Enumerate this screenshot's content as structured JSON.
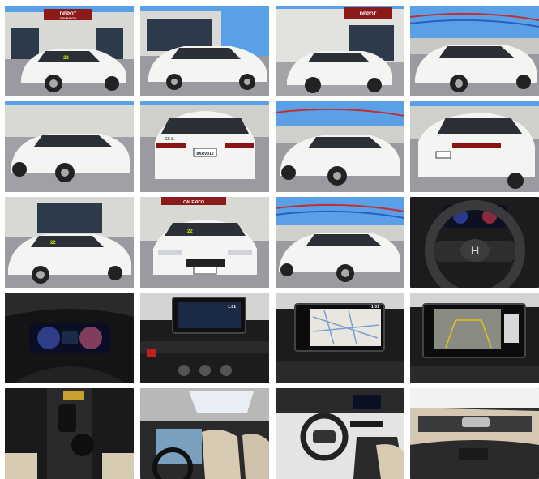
{
  "gallery": {
    "dealer_sign_line1": "DEPOT",
    "dealer_sign_line2": "CALEXICO",
    "dealer_sign_short": "CALEXICO",
    "windshield_tag": "22",
    "plate_text": "8XRV312",
    "trim_badge": "EX-L",
    "screen_time": "1:01"
  },
  "colors": {
    "car_body": "#f4f4f2",
    "sky": "#5aa0e6",
    "asphalt": "#9a9aa0",
    "building": "#d8d8d4",
    "glass": "#2d3a4a",
    "interior_dark": "#1c1c1e",
    "leather": "#d8cbb4"
  },
  "photos": [
    {
      "icon": "car-front-dealer-photo"
    },
    {
      "icon": "car-side-front-photo"
    },
    {
      "icon": "car-front-building-photo"
    },
    {
      "icon": "car-front-flags-photo"
    },
    {
      "icon": "car-side-profile-photo"
    },
    {
      "icon": "car-rear-photo"
    },
    {
      "icon": "car-side-three-quarter-photo"
    },
    {
      "icon": "car-rear-three-quarter-photo"
    },
    {
      "icon": "car-front-left-photo"
    },
    {
      "icon": "car-front-straight-photo"
    },
    {
      "icon": "car-front-right-photo"
    },
    {
      "icon": "steering-wheel-photo"
    },
    {
      "icon": "instrument-cluster-photo"
    },
    {
      "icon": "dashboard-audio-photo"
    },
    {
      "icon": "navigation-screen-photo"
    },
    {
      "icon": "backup-camera-photo"
    },
    {
      "icon": "center-console-photo"
    },
    {
      "icon": "sunroof-interior-photo"
    },
    {
      "icon": "dashboard-wide-photo"
    },
    {
      "icon": "door-panel-photo"
    }
  ]
}
